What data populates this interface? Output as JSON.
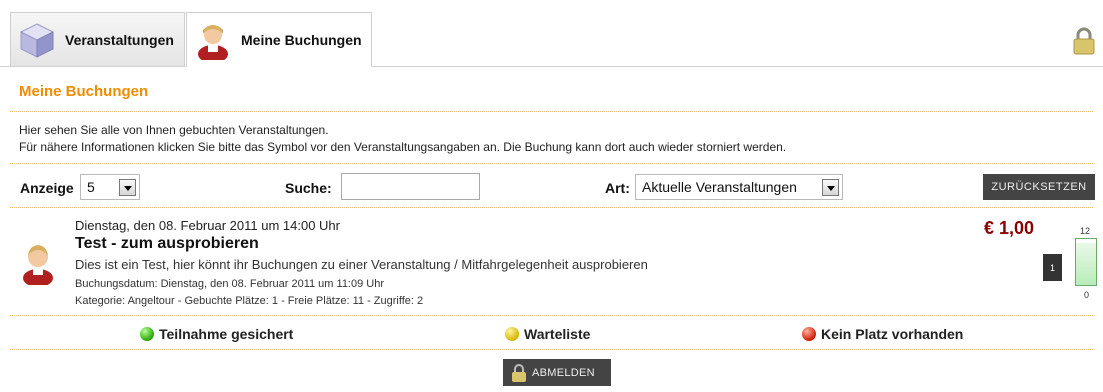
{
  "tabs": [
    {
      "label": "Veranstaltungen",
      "icon": "cube-icon"
    },
    {
      "label": "Meine Buchungen",
      "icon": "user-avatar-icon",
      "active": true
    }
  ],
  "section_title": "Meine Buchungen",
  "intro": {
    "line1": "Hier sehen Sie alle von Ihnen gebuchten Veranstaltungen.",
    "line2": "Für nähere Informationen klicken Sie bitte das Symbol vor den Veranstaltungsangaben an. Die Buchung kann dort auch wieder storniert werden."
  },
  "filters": {
    "anzeige_label": "Anzeige",
    "anzeige_value": "5",
    "suche_label": "Suche:",
    "suche_value": "",
    "art_label": "Art:",
    "art_value": "Aktuelle Veranstaltungen",
    "reset_label": "ZURÜCKSETZEN"
  },
  "booking": {
    "date": "Dienstag, den 08. Februar 2011 um 14:00 Uhr",
    "title": "Test - zum ausprobieren",
    "description": "Dies ist ein Test, hier könnt ihr Buchungen zu einer Veranstaltung / Mitfahrgelegenheit ausprobieren",
    "booking_date": "Buchungsdatum: Dienstag, den 08. Februar 2011 um 11:09 Uhr",
    "meta": "Kategorie: Angeltour - Gebuchte Plätze: 1 - Freie Plätze: 11 - Zugriffe: 2",
    "price": "€ 1,00",
    "count": "1",
    "capacity_max": "12",
    "capacity_min": "0",
    "capacity_fill_fraction": 0.92
  },
  "legend": {
    "green": "Teilnahme gesichert",
    "yellow": "Warteliste",
    "red": "Kein Platz vorhanden"
  },
  "abmelden_label": "ABMELDEN",
  "colors": {
    "accent": "#f08c00",
    "price": "#8b0000",
    "button": "#444444"
  }
}
